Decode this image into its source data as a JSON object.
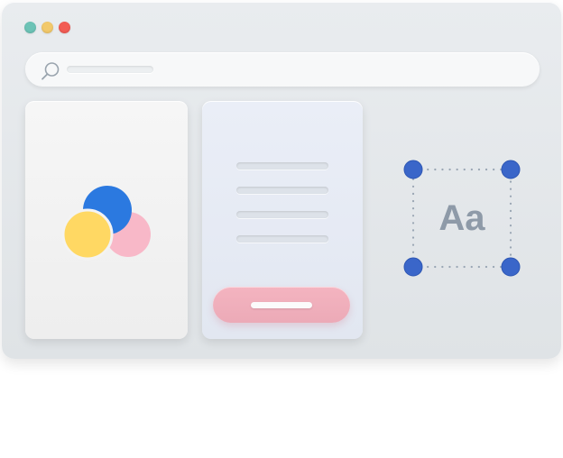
{
  "window": {
    "traffic_lights": [
      {
        "name": "green",
        "color": "#6cc3b6"
      },
      {
        "name": "yellow",
        "color": "#f2c96b"
      },
      {
        "name": "red",
        "color": "#f25c54"
      }
    ]
  },
  "search": {
    "icon": "search-icon"
  },
  "palette_card": {
    "circles": [
      {
        "name": "blue",
        "color": "#2b79e0"
      },
      {
        "name": "yellow",
        "color": "#ffd863"
      },
      {
        "name": "pink",
        "color": "#f8b8c8"
      }
    ]
  },
  "form_card": {
    "line_count": 4,
    "button_color": "#efb0bc"
  },
  "text_selection": {
    "label": "Aa",
    "handle_color": "#3a66c9"
  }
}
